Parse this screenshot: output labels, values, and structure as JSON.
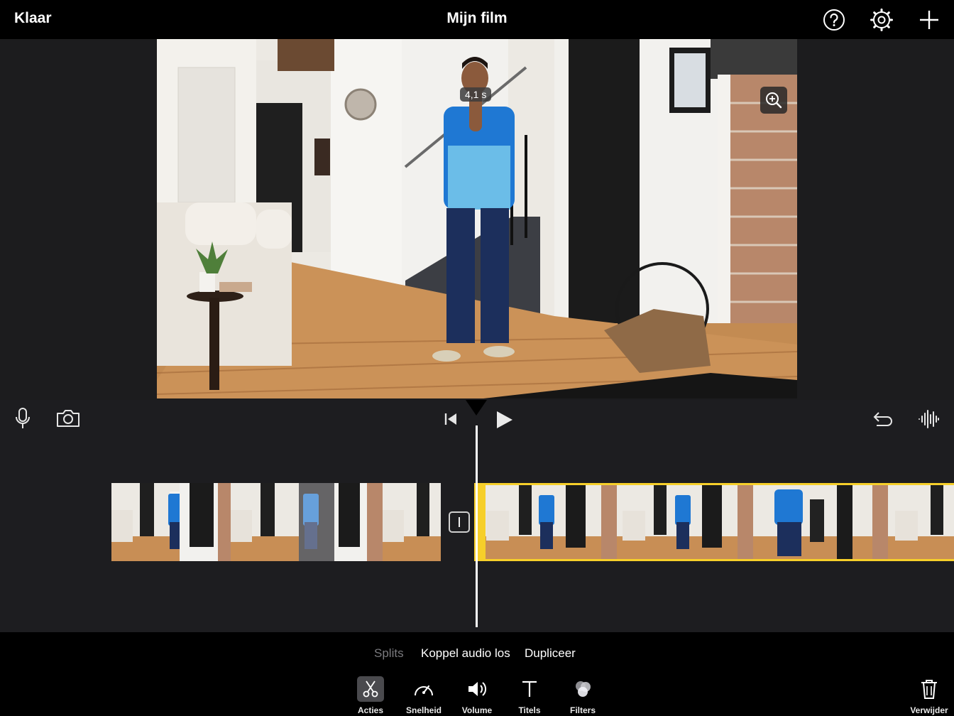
{
  "topbar": {
    "done_label": "Klaar",
    "title": "Mijn film",
    "icons": [
      "help-icon",
      "settings-icon",
      "add-icon"
    ]
  },
  "viewer": {
    "duration_badge": "4,1 s",
    "zoom_icon": "zoom-in-icon"
  },
  "timeline": {
    "left_icons": [
      "microphone-icon",
      "camera-icon"
    ],
    "center_icons": [
      "skip-to-start-icon",
      "play-icon"
    ],
    "right_icons": [
      "undo-icon",
      "audio-waveform-icon"
    ]
  },
  "actions": {
    "split": "Splits",
    "detach_audio": "Koppel audio los",
    "duplicate": "Dupliceer"
  },
  "tools": [
    {
      "label": "Acties",
      "icon": "scissors-icon",
      "active": true
    },
    {
      "label": "Snelheid",
      "icon": "speedometer-icon",
      "active": false
    },
    {
      "label": "Volume",
      "icon": "speaker-icon",
      "active": false
    },
    {
      "label": "Titels",
      "icon": "text-icon",
      "active": false
    },
    {
      "label": "Filters",
      "icon": "filters-icon",
      "active": false
    }
  ],
  "delete_label": "Verwijder",
  "colors": {
    "accent_yellow": "#f6cf2a",
    "timeline_bg": "#1d1d20",
    "toolbar_bg": "#000000"
  }
}
